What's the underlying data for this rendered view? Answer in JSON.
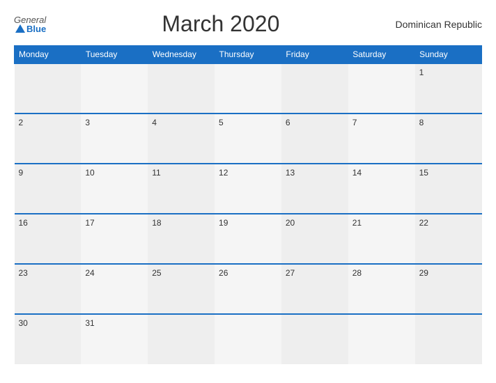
{
  "header": {
    "logo": {
      "general": "General",
      "blue": "Blue",
      "triangle": true
    },
    "title": "March 2020",
    "country": "Dominican Republic"
  },
  "calendar": {
    "days_of_week": [
      "Monday",
      "Tuesday",
      "Wednesday",
      "Thursday",
      "Friday",
      "Saturday",
      "Sunday"
    ],
    "weeks": [
      [
        "",
        "",
        "",
        "",
        "",
        "",
        "1"
      ],
      [
        "2",
        "3",
        "4",
        "5",
        "6",
        "7",
        "8"
      ],
      [
        "9",
        "10",
        "11",
        "12",
        "13",
        "14",
        "15"
      ],
      [
        "16",
        "17",
        "18",
        "19",
        "20",
        "21",
        "22"
      ],
      [
        "23",
        "24",
        "25",
        "26",
        "27",
        "28",
        "29"
      ],
      [
        "30",
        "31",
        "",
        "",
        "",
        "",
        ""
      ]
    ]
  }
}
